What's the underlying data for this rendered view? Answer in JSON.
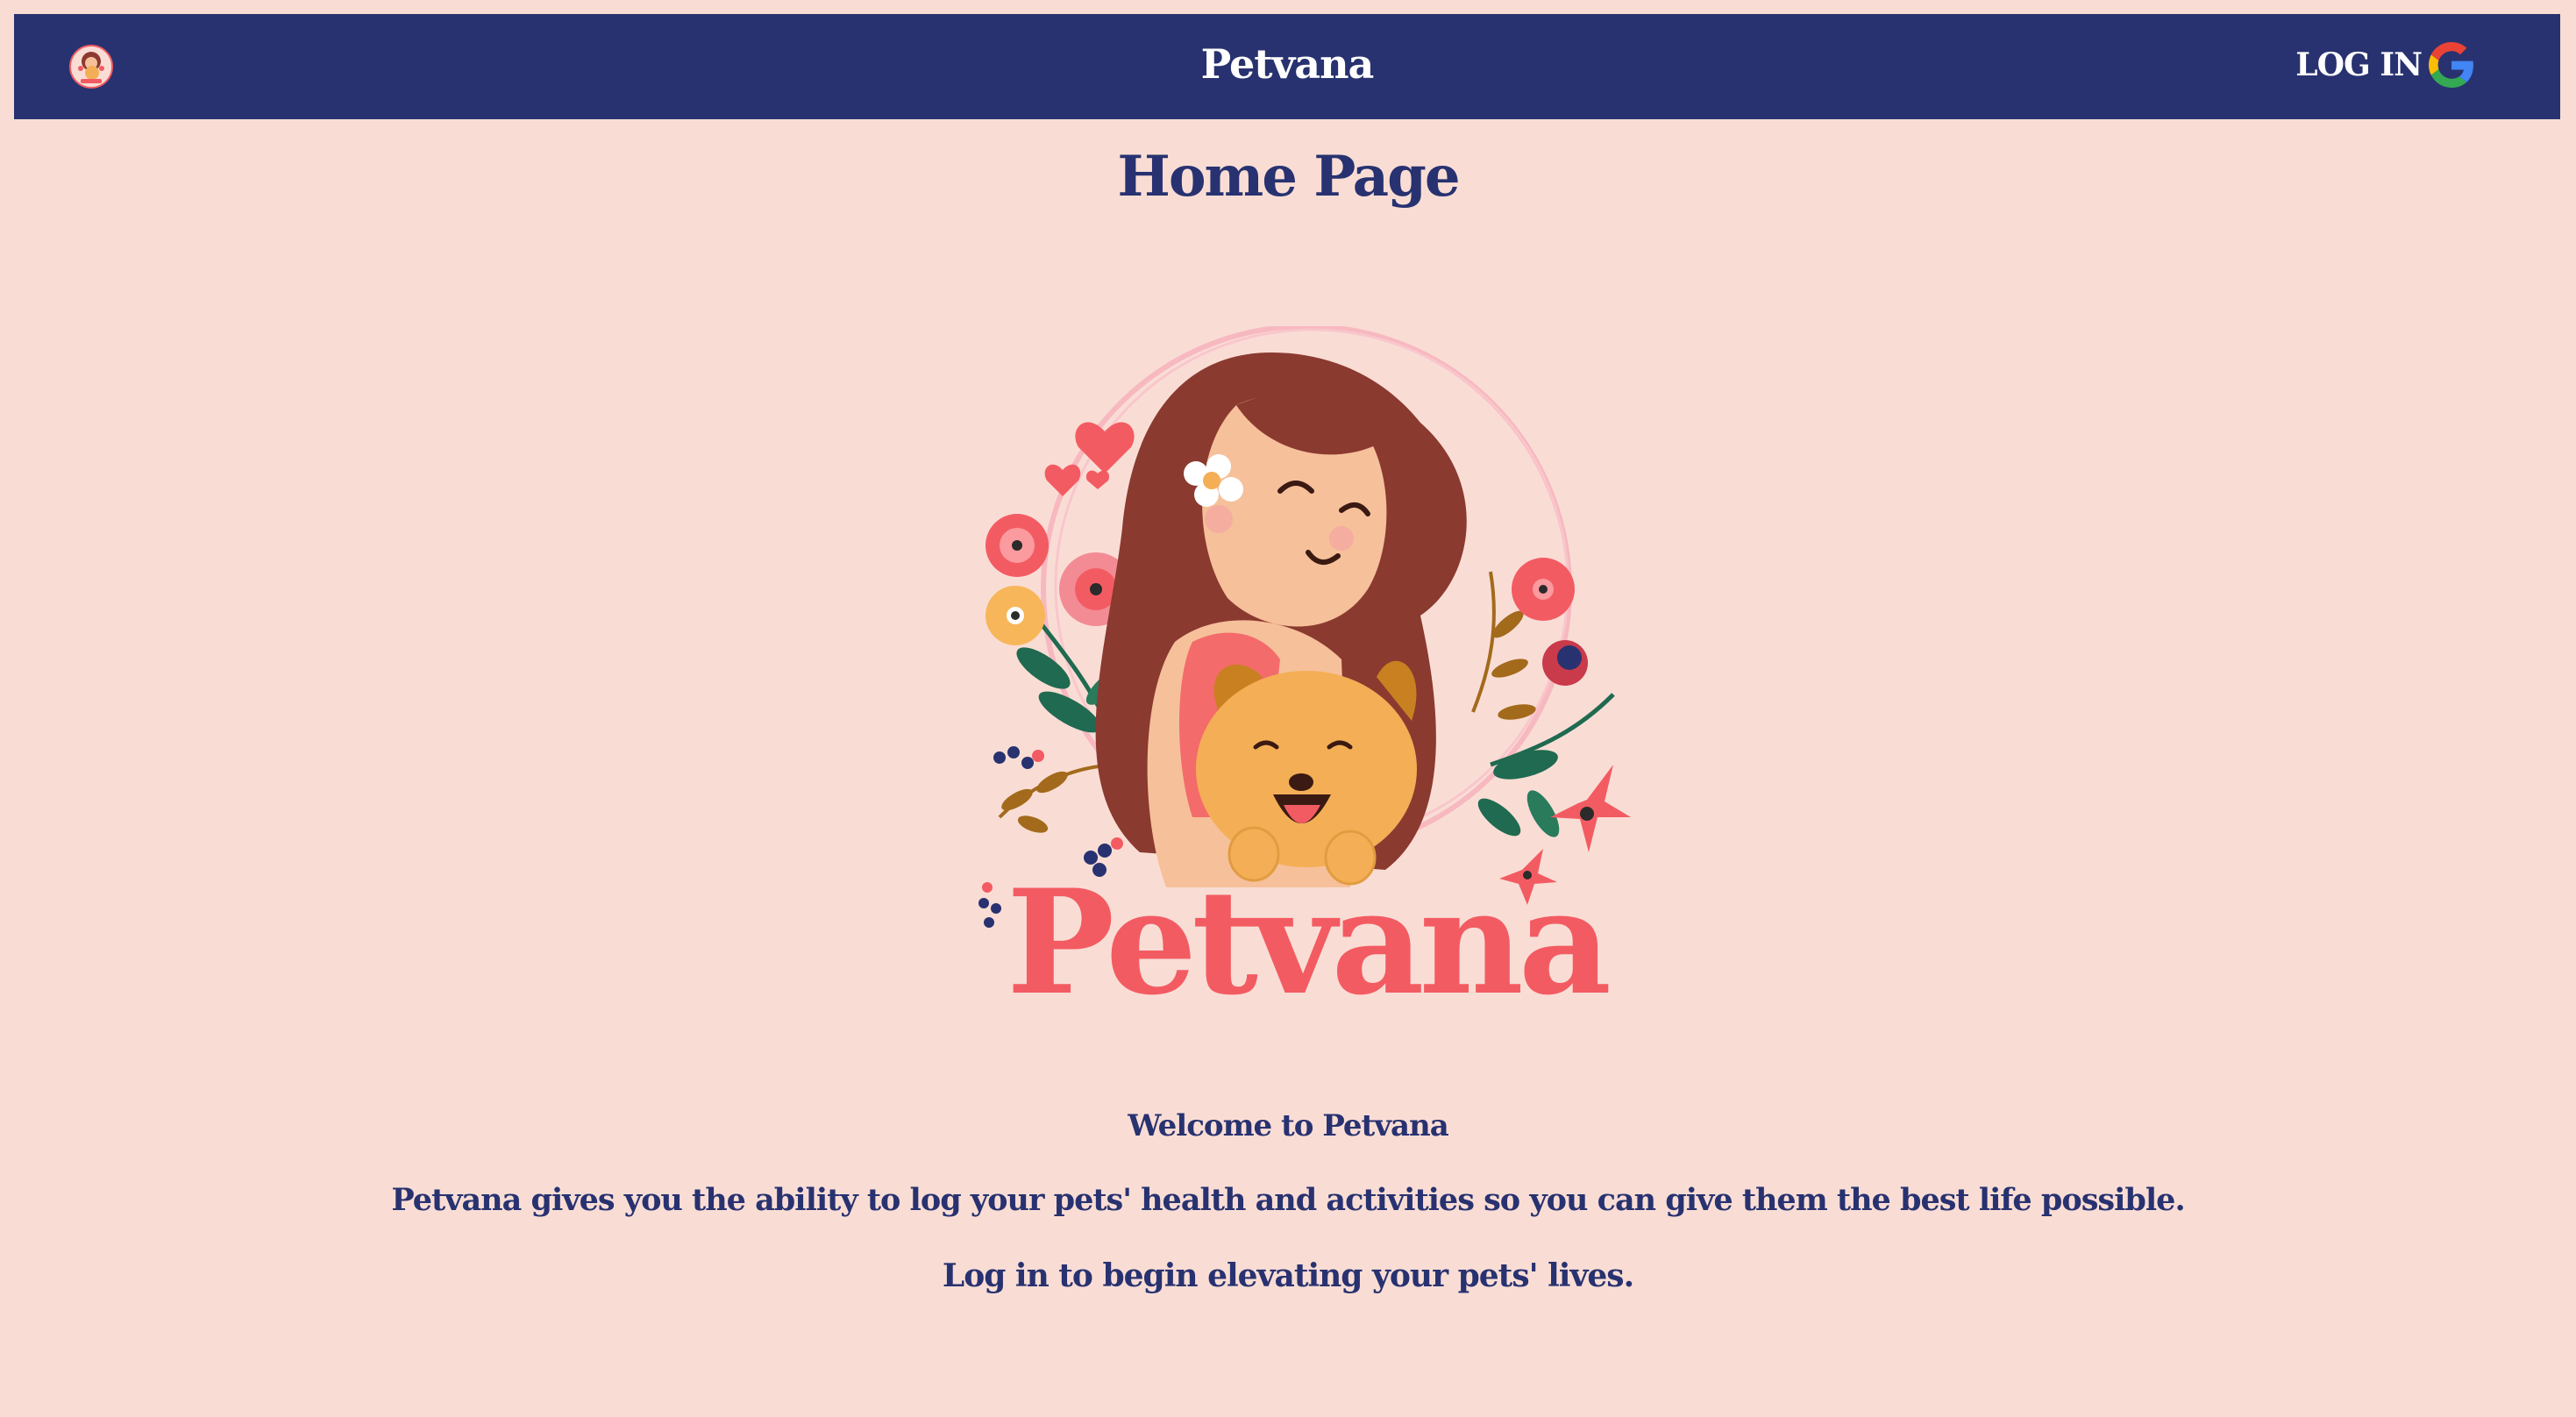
{
  "navbar": {
    "brand": "Petvana",
    "login_label": "LOG IN",
    "logo_icon": "petvana-logo-icon",
    "login_icon": "google-g-icon"
  },
  "main": {
    "title": "Home Page",
    "hero_wordmark": "Petvana",
    "welcome": "Welcome to Petvana",
    "description": "Petvana gives you the ability to log your pets' health and activities so you can give them the best life possible.",
    "cta": "Log in to begin elevating your pets' lives."
  },
  "colors": {
    "background": "#f9ddd5",
    "navbar": "#283270",
    "navy_text": "#283270",
    "brand_coral": "#f35b62",
    "hair": "#8b3a30",
    "dog": "#f4ae55"
  }
}
